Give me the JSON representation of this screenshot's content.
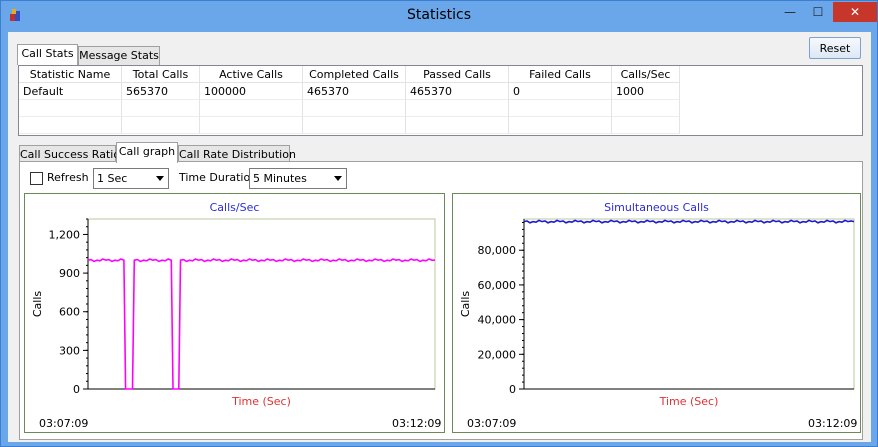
{
  "window": {
    "title": "Statistics",
    "min_glyph": "—",
    "max_glyph": "☐",
    "close_glyph": "✕",
    "app_icon": "stacked-blocks-icon"
  },
  "toolbar": {
    "reset_label": "Reset"
  },
  "top_tabs": [
    {
      "label": "Call Stats",
      "active": true
    },
    {
      "label": "Message Stats",
      "active": false
    }
  ],
  "stats_table": {
    "columns": [
      "Statistic Name",
      "Total Calls",
      "Active Calls",
      "Completed Calls",
      "Passed Calls",
      "Failed Calls",
      "Calls/Sec"
    ],
    "rows": [
      [
        "Default",
        "565370",
        "100000",
        "465370",
        "465370",
        "0",
        "1000"
      ]
    ]
  },
  "graph_tabs": [
    {
      "label": "Call Success Ratio",
      "active": false
    },
    {
      "label": "Call graph",
      "active": true
    },
    {
      "label": "Call Rate Distribution",
      "active": false
    }
  ],
  "controls": {
    "refresh_label": "Refresh",
    "refresh_checked": false,
    "refresh_interval": "1 Sec",
    "time_duration_label": "Time Duration",
    "time_duration": "5 Minutes"
  },
  "colors": {
    "calls_sec_line": "#ff00ff",
    "simultaneous_line": "#1a1ad0",
    "chart_title": "#2b2bd8",
    "axis_label": "#e03030"
  },
  "chart_data": [
    {
      "type": "line",
      "title": "Calls/Sec",
      "xlabel": "Time (Sec)",
      "ylabel": "Calls",
      "ylim": [
        0,
        1320
      ],
      "yticks": [
        0,
        300,
        600,
        900,
        1200
      ],
      "ytick_labels": [
        "0",
        "300",
        "600",
        "900",
        "1,200"
      ],
      "x_start_label": "03:07:09",
      "x_end_label": "03:12:09",
      "xlim": [
        0,
        300
      ],
      "x": [
        0,
        31,
        32.5,
        38.5,
        40,
        72,
        73.5,
        78.5,
        80,
        300
      ],
      "y": [
        1000,
        1000,
        0,
        0,
        1000,
        1000,
        0,
        0,
        1000,
        1000
      ],
      "grid": false
    },
    {
      "type": "line",
      "title": "Simultaneous Calls",
      "xlabel": "Time (Sec)",
      "ylabel": "Calls",
      "ylim": [
        0,
        98000
      ],
      "yticks": [
        0,
        20000,
        40000,
        60000,
        80000
      ],
      "ytick_labels": [
        "0",
        "20,000",
        "40,000",
        "60,000",
        "80,000"
      ],
      "x_start_label": "03:07:09",
      "x_end_label": "03:12:09",
      "xlim": [
        0,
        300
      ],
      "x": [
        0,
        300
      ],
      "y": [
        96500,
        96500
      ],
      "grid": false
    }
  ]
}
